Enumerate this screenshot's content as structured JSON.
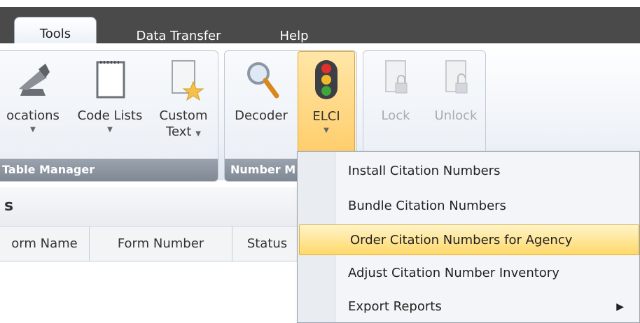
{
  "tabs": [
    {
      "label": "Tools",
      "active": true
    },
    {
      "label": "Data Transfer",
      "active": false
    },
    {
      "label": "Help",
      "active": false
    }
  ],
  "ribbon": {
    "table_manager": {
      "label": "Table Manager",
      "buttons": [
        {
          "label": "ocations",
          "icon": "stapler-icon"
        },
        {
          "label": "Code Lists",
          "icon": "notepad-icon"
        },
        {
          "label": "Custom",
          "label2": "Text",
          "icon": "document-star-icon"
        }
      ]
    },
    "number_manager": {
      "label": "Number M",
      "buttons": [
        {
          "label": "Decoder",
          "icon": "magnifier-icon"
        },
        {
          "label": "ELCI",
          "icon": "traffic-light-icon"
        }
      ]
    },
    "lock_group": {
      "buttons": [
        {
          "label": "Lock",
          "icon": "document-lock-icon"
        },
        {
          "label": "Unlock",
          "icon": "document-unlock-icon"
        }
      ]
    }
  },
  "section": {
    "title": "s"
  },
  "columns": [
    "orm Name",
    "Form Number",
    "Status"
  ],
  "menu": {
    "items": [
      {
        "label": "Install Citation Numbers"
      },
      {
        "label": "Bundle Citation Numbers"
      },
      {
        "label": "Order Citation Numbers for Agency",
        "highlighted": true
      },
      {
        "label": "Adjust Citation Number Inventory"
      },
      {
        "label": "Export Reports",
        "submenu_arrow": "▶"
      }
    ]
  },
  "colors": {
    "tab_bar": "#4a4a4a",
    "highlight": "#ffd86a",
    "group_label": "#8a939e"
  }
}
